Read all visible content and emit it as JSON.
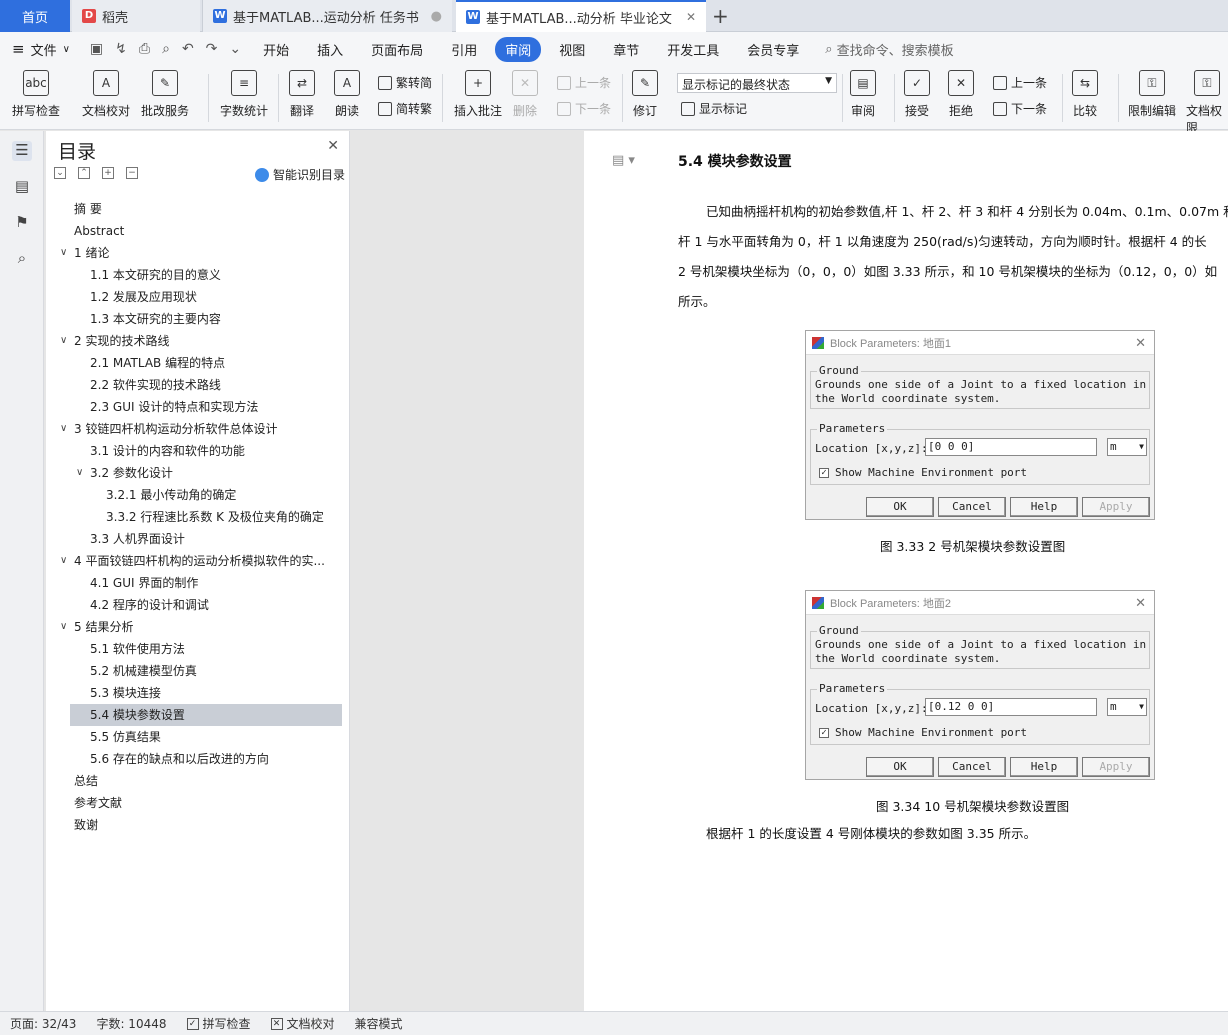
{
  "tabs": {
    "home": "首页",
    "draft": "稻壳",
    "doc1": "基于MATLAB...运动分析 任务书",
    "doc2": "基于MATLAB...动分析 毕业论文"
  },
  "menu": {
    "file": "文件",
    "items": [
      "开始",
      "插入",
      "页面布局",
      "引用",
      "审阅",
      "视图",
      "章节",
      "开发工具",
      "会员专享"
    ],
    "search": "查找命令、搜索模板"
  },
  "ribbon": {
    "spell": "拼写检查",
    "proof": "文档校对",
    "correction": "批改服务",
    "wordcount": "字数统计",
    "translate": "翻译",
    "read": "朗读",
    "trad": "繁转简",
    "simp": "简转繁",
    "insert_comment": "插入批注",
    "delete": "删除",
    "prev_comment": "上一条",
    "next_comment": "下一条",
    "revise": "修订",
    "markup_state": "显示标记的最终状态",
    "show_markup": "显示标记",
    "review": "审阅",
    "accept": "接受",
    "reject": "拒绝",
    "prev_change": "上一条",
    "next_change": "下一条",
    "compare": "比较",
    "restrict": "限制编辑",
    "doc_perm": "文档权限"
  },
  "toc": {
    "title": "目录",
    "smart": "智能识别目录",
    "items": [
      {
        "label": "摘  要",
        "level": 0,
        "chev": ""
      },
      {
        "label": "Abstract",
        "level": 0,
        "chev": ""
      },
      {
        "label": "1  绪论",
        "level": 0,
        "chev": "v"
      },
      {
        "label": "1.1  本文研究的目的意义",
        "level": 1,
        "chev": ""
      },
      {
        "label": "1.2  发展及应用现状",
        "level": 1,
        "chev": ""
      },
      {
        "label": "1.3  本文研究的主要内容",
        "level": 1,
        "chev": ""
      },
      {
        "label": "2  实现的技术路线",
        "level": 0,
        "chev": "v"
      },
      {
        "label": "2.1 MATLAB 编程的特点",
        "level": 1,
        "chev": ""
      },
      {
        "label": "2.2  软件实现的技术路线",
        "level": 1,
        "chev": ""
      },
      {
        "label": "2.3 GUI 设计的特点和实现方法",
        "level": 1,
        "chev": ""
      },
      {
        "label": "3  铰链四杆机构运动分析软件总体设计",
        "level": 0,
        "chev": "v"
      },
      {
        "label": "3.1  设计的内容和软件的功能",
        "level": 1,
        "chev": ""
      },
      {
        "label": "3.2  参数化设计",
        "level": 1,
        "chev": "v"
      },
      {
        "label": "3.2.1  最小传动角的确定",
        "level": 2,
        "chev": ""
      },
      {
        "label": "3.3.2  行程速比系数 K 及极位夹角的确定",
        "level": 2,
        "chev": ""
      },
      {
        "label": "3.3  人机界面设计",
        "level": 1,
        "chev": ""
      },
      {
        "label": "4  平面铰链四杆机构的运动分析模拟软件的实...",
        "level": 0,
        "chev": "v"
      },
      {
        "label": "4.1 GUI 界面的制作",
        "level": 1,
        "chev": ""
      },
      {
        "label": "4.2  程序的设计和调试",
        "level": 1,
        "chev": ""
      },
      {
        "label": "5  结果分析",
        "level": 0,
        "chev": "v"
      },
      {
        "label": "5.1 软件使用方法",
        "level": 1,
        "chev": ""
      },
      {
        "label": "5.2  机械建模型仿真",
        "level": 1,
        "chev": ""
      },
      {
        "label": "5.3  模块连接",
        "level": 1,
        "chev": ""
      },
      {
        "label": "5.4  模块参数设置",
        "level": 1,
        "chev": "",
        "active": true
      },
      {
        "label": "5.5  仿真结果",
        "level": 1,
        "chev": ""
      },
      {
        "label": "5.6  存在的缺点和以后改进的方向",
        "level": 1,
        "chev": ""
      },
      {
        "label": "总结",
        "level": 0,
        "chev": ""
      },
      {
        "label": "参考文献",
        "level": 0,
        "chev": ""
      },
      {
        "label": "致谢",
        "level": 0,
        "chev": ""
      }
    ]
  },
  "doc": {
    "heading": "5.4  模块参数设置",
    "para_lines": [
      "已知曲柄摇杆机构的初始参数值,杆 1、杆 2、杆 3 和杆 4 分别长为 0.04m、0.1m、0.07m 和",
      "杆 1 与水平面转角为 0，杆 1 以角速度为 250(rad/s)匀速转动，方向为顺时针。根据杆 4 的长",
      "2 号机架模块坐标为（0，0，0）如图 3.33 所示，和 10 号机架模块的坐标为（0.12，0，0）如",
      "所示。"
    ],
    "dialog1": {
      "title": "Block Parameters: 地面1",
      "group1": "Ground",
      "desc": "Grounds one side of a Joint to a fixed location in the World coordinate system.",
      "group2": "Parameters",
      "loc_label": "Location [x,y,z]:",
      "loc_value": "[0 0 0]",
      "unit": "m",
      "checkbox": "Show Machine Environment port",
      "ok": "OK",
      "cancel": "Cancel",
      "help": "Help",
      "apply": "Apply"
    },
    "caption1": "图 3.33  2 号机架模块参数设置图",
    "dialog2": {
      "title": "Block Parameters: 地面2",
      "group1": "Ground",
      "desc": "Grounds one side of a Joint to a fixed location in the World coordinate system.",
      "group2": "Parameters",
      "loc_label": "Location [x,y,z]:",
      "loc_value": "[0.12 0 0]",
      "unit": "m",
      "checkbox": "Show Machine Environment port",
      "ok": "OK",
      "cancel": "Cancel",
      "help": "Help",
      "apply": "Apply"
    },
    "caption2": "图 3.34  10 号机架模块参数设置图",
    "para2": "根据杆 1 的长度设置 4 号刚体模块的参数如图 3.35 所示。"
  },
  "status": {
    "page": "页面: 32/43",
    "words": "字数: 10448",
    "spell": "拼写检查",
    "proof": "文档校对",
    "compat": "兼容模式"
  },
  "colors": {
    "accent": "#2f6fde",
    "toc_active": "#c9ced6"
  }
}
